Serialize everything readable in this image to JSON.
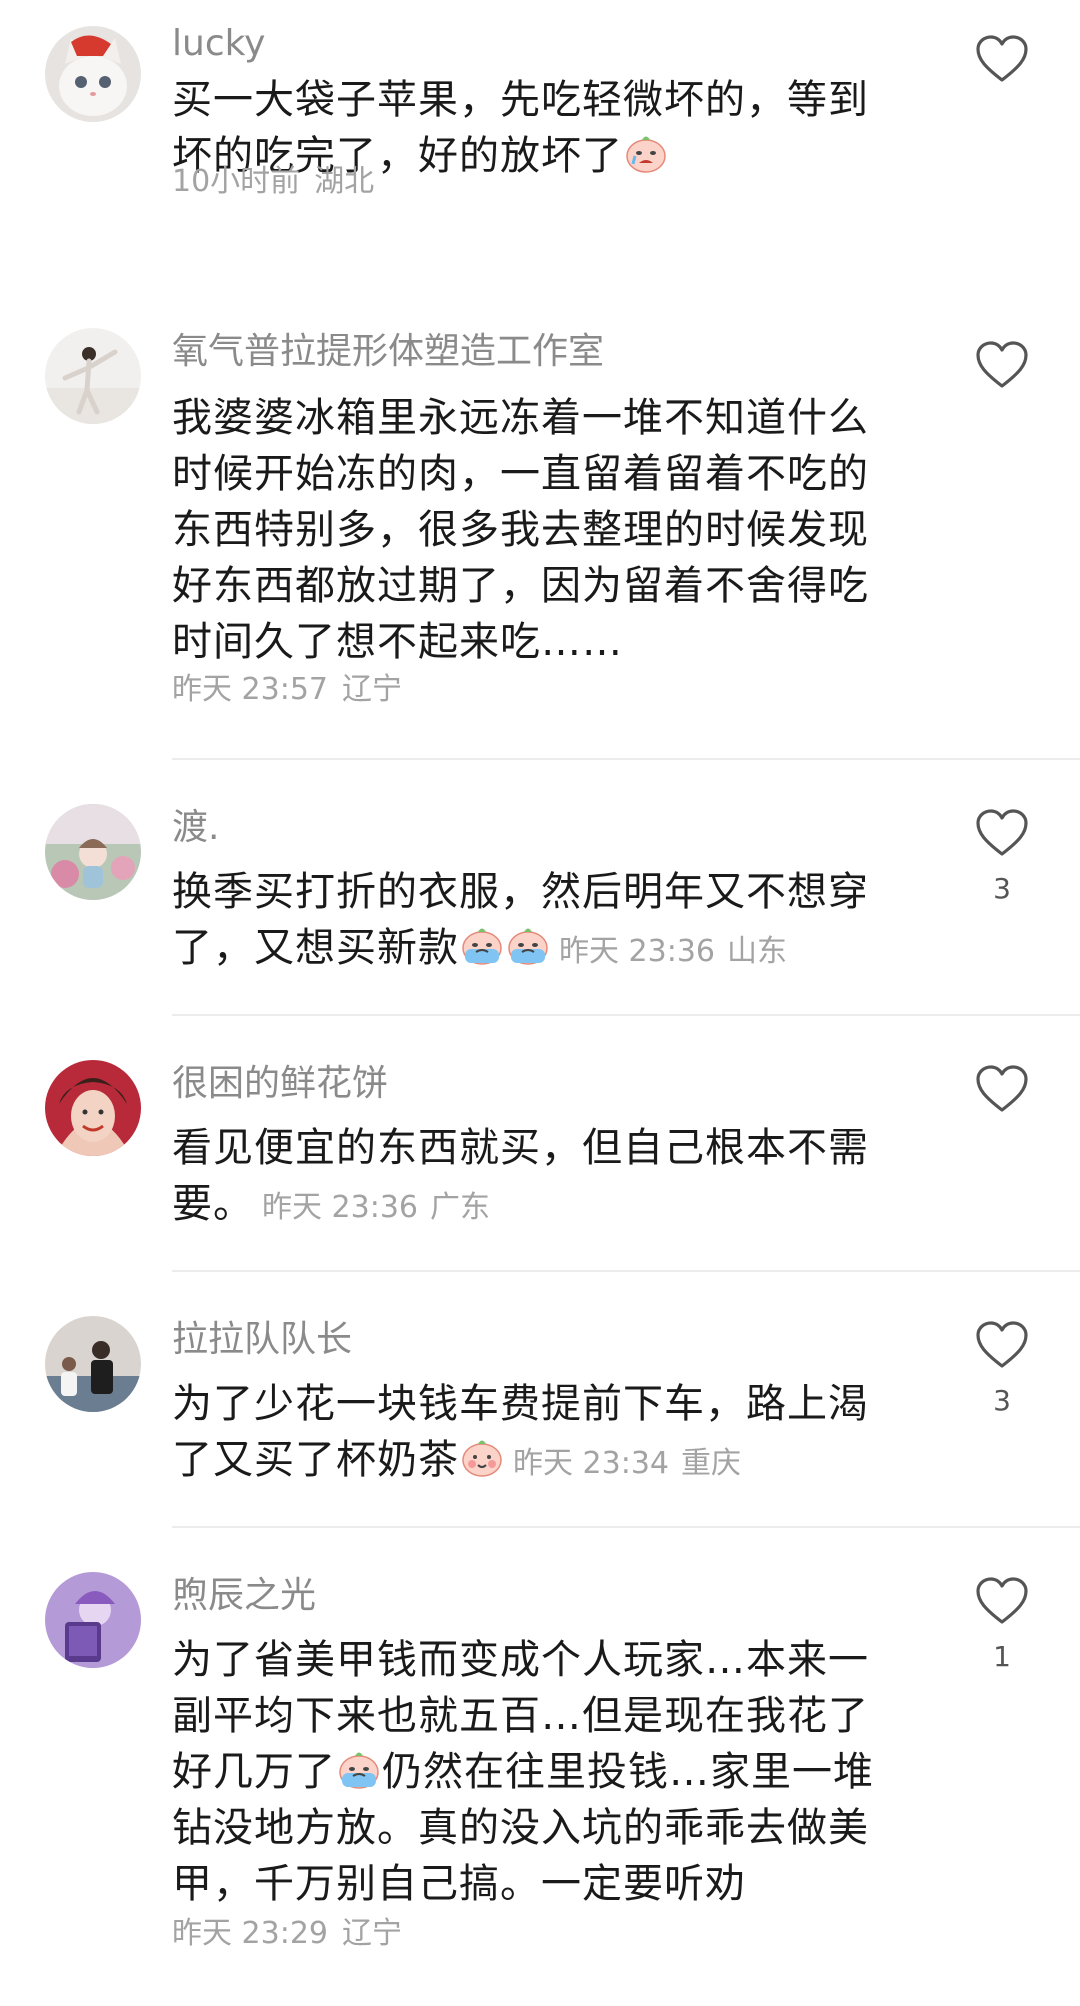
{
  "comments": [
    {
      "username": "lucky",
      "text": "买一大袋子苹果，先吃轻微坏的，等到坏的吃完了，好的放坏了",
      "emojis": [
        "crying-face-emoji"
      ],
      "time": "10小时前",
      "location": "湖北",
      "likes": ""
    },
    {
      "username": "氧气普拉提形体塑造工作室",
      "text": "我婆婆冰箱里永远冻着一堆不知道什么时候开始冻的肉，一直留着留着不吃的东西特别多，很多我去整理的时候发现好东西都放过期了，因为留着不舍得吃时间久了想不起来吃……",
      "emojis": [],
      "time": "昨天 23:57",
      "location": "辽宁",
      "likes": ""
    },
    {
      "username": "渡.",
      "text": "换季买打折的衣服，然后明年又不想穿了，又想买新款",
      "emojis": [
        "crying-blue-face-emoji",
        "crying-blue-face-emoji"
      ],
      "time": "昨天 23:36",
      "location": "山东",
      "likes": "3"
    },
    {
      "username": "很困的鲜花饼",
      "text": "看见便宜的东西就买，但自己根本不需要。",
      "emojis": [],
      "time": "昨天 23:36",
      "location": "广东",
      "likes": ""
    },
    {
      "username": "拉拉队队长",
      "text": "为了少花一块钱车费提前下车，路上渴了又买了杯奶茶",
      "emojis": [
        "shy-face-emoji"
      ],
      "time": "昨天 23:34",
      "location": "重庆",
      "likes": "3"
    },
    {
      "username": "煦辰之光",
      "text_parts": [
        "为了省美甲钱而变成个人玩家…本来一副平均下来也就五百…但是现在我花了好几万了",
        "仍然在往里投钱…家里一堆钻没地方放。真的没入坑的乖乖去做美甲，千万别自己搞。一定要听劝"
      ],
      "emojis": [
        "crying-blue-face-emoji"
      ],
      "time": "昨天 23:29",
      "location": "辽宁",
      "likes": "1"
    }
  ]
}
